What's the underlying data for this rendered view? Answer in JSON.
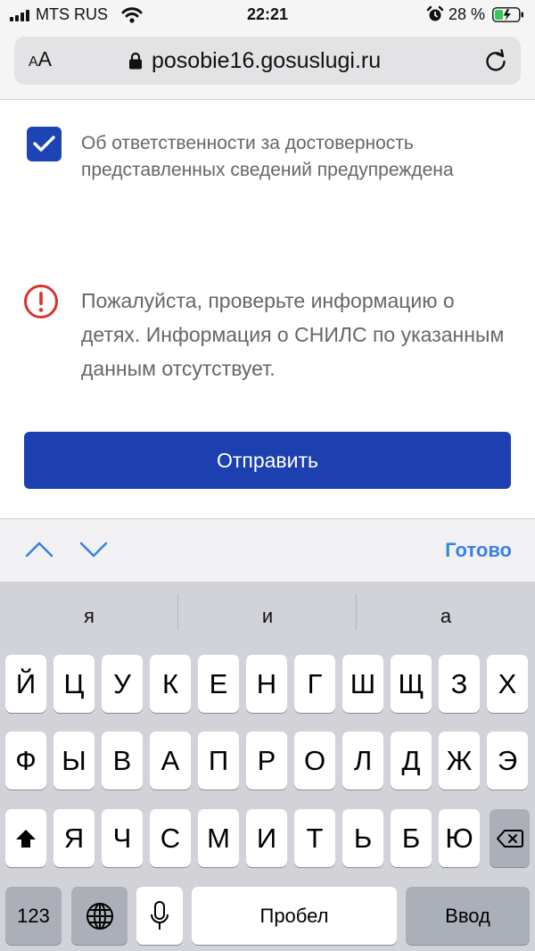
{
  "status_bar": {
    "carrier": "MTS RUS",
    "time": "22:21",
    "battery_percent": "28 %"
  },
  "browser": {
    "text_size_small": "A",
    "text_size_large": "A",
    "url": "posobie16.gosuslugi.ru"
  },
  "form": {
    "checkbox_checked": true,
    "checkbox_label": "Об ответственности за достоверность представленных сведений предупреждена",
    "error_message": "Пожалуйста, проверьте информацию о детях. Информация о СНИЛС по указанным данным отсутствует.",
    "submit_label": "Отправить",
    "accent_color": "#1c40b0",
    "error_color": "#d9342b"
  },
  "accessory_bar": {
    "done_label": "Готово"
  },
  "keyboard": {
    "suggestions": [
      "я",
      "и",
      "а"
    ],
    "row1": [
      "Й",
      "Ц",
      "У",
      "К",
      "Е",
      "Н",
      "Г",
      "Ш",
      "Щ",
      "З",
      "Х"
    ],
    "row2": [
      "Ф",
      "Ы",
      "В",
      "А",
      "П",
      "Р",
      "О",
      "Л",
      "Д",
      "Ж",
      "Э"
    ],
    "row3": [
      "Я",
      "Ч",
      "С",
      "М",
      "И",
      "Т",
      "Ь",
      "Б",
      "Ю"
    ],
    "numbers_label": "123",
    "space_label": "Пробел",
    "return_label": "Ввод"
  }
}
